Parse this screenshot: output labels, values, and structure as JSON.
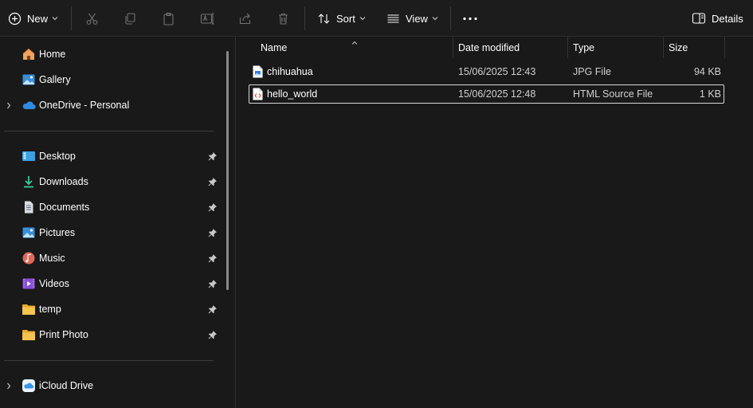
{
  "toolbar": {
    "new_label": "New",
    "sort_label": "Sort",
    "view_label": "View",
    "details_label": "Details"
  },
  "sidebar": {
    "top_items": [
      {
        "label": "Home",
        "icon": "home-icon"
      },
      {
        "label": "Gallery",
        "icon": "gallery-icon"
      },
      {
        "label": "OneDrive - Personal",
        "icon": "onedrive-icon"
      }
    ],
    "quick_access": [
      {
        "label": "Desktop",
        "icon": "desktop-icon"
      },
      {
        "label": "Downloads",
        "icon": "downloads-icon"
      },
      {
        "label": "Documents",
        "icon": "documents-icon"
      },
      {
        "label": "Pictures",
        "icon": "pictures-icon"
      },
      {
        "label": "Music",
        "icon": "music-icon"
      },
      {
        "label": "Videos",
        "icon": "videos-icon"
      },
      {
        "label": "temp",
        "icon": "folder-icon"
      },
      {
        "label": "Print Photo",
        "icon": "folder-icon"
      }
    ],
    "bottom_items": [
      {
        "label": "iCloud Drive",
        "icon": "icloud-icon"
      }
    ]
  },
  "columns": {
    "name": "Name",
    "date": "Date modified",
    "type": "Type",
    "size": "Size"
  },
  "files": [
    {
      "name": "chihuahua",
      "date": "15/06/2025 12:43",
      "type": "JPG File",
      "size": "94 KB",
      "icon": "jpg-file-icon"
    },
    {
      "name": "hello_world",
      "date": "15/06/2025 12:48",
      "type": "HTML Source File",
      "size": "1 KB",
      "icon": "html-file-icon"
    }
  ],
  "colors": {
    "background": "#191919",
    "accent_blue": "#4ca0e0",
    "folder_yellow": "#f2c14e",
    "selection_border": "#d8d8d8"
  }
}
